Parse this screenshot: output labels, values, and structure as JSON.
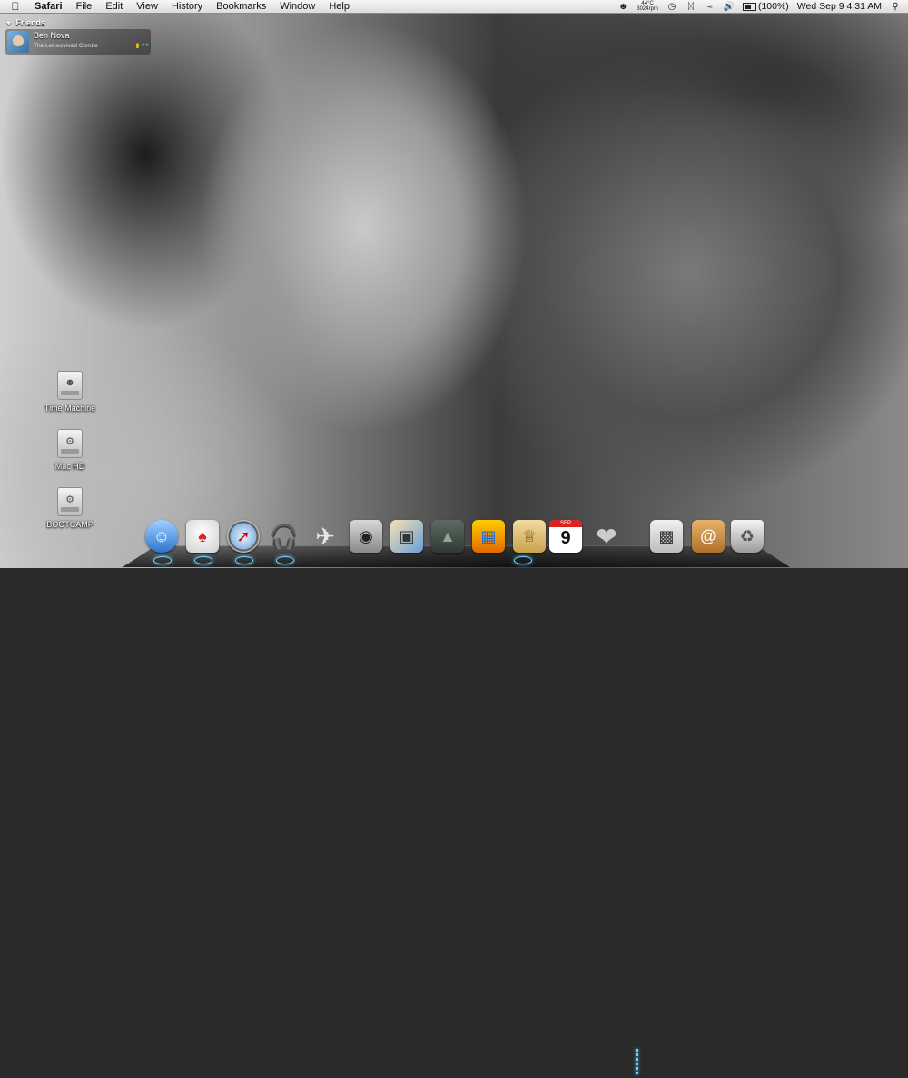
{
  "menubar": {
    "app_name": "Safari",
    "menus": [
      "File",
      "Edit",
      "View",
      "History",
      "Bookmarks",
      "Window",
      "Help"
    ],
    "status": {
      "temperature": "44°C",
      "fan": "3024rpm",
      "battery": "(100%)",
      "clock": "Wed Sep 9  4 31 AM"
    }
  },
  "friends": {
    "header": "Friends",
    "name": "Ben Nova",
    "status_message": "The Let survived Combe"
  },
  "desktop_icons": [
    {
      "label": "Time Machine"
    },
    {
      "label": "Mac HD"
    },
    {
      "label": "BOOTCAMP"
    }
  ],
  "dock": {
    "items": [
      {
        "icon": "finder-icon"
      },
      {
        "icon": "adium-icon"
      },
      {
        "icon": "safari-icon"
      },
      {
        "icon": "itunes-icon"
      },
      {
        "icon": "transmit-icon"
      },
      {
        "icon": "camera-icon"
      },
      {
        "icon": "iphoto-icon"
      },
      {
        "icon": "stone-icon"
      },
      {
        "icon": "app-icon"
      },
      {
        "icon": "stamp-icon"
      },
      {
        "icon": "ical-icon",
        "month": "SEP",
        "day": "9"
      },
      {
        "icon": "heart-icon"
      },
      {
        "icon": "downloads-icon"
      },
      {
        "icon": "address-book-icon"
      },
      {
        "icon": "trash-icon"
      }
    ]
  }
}
